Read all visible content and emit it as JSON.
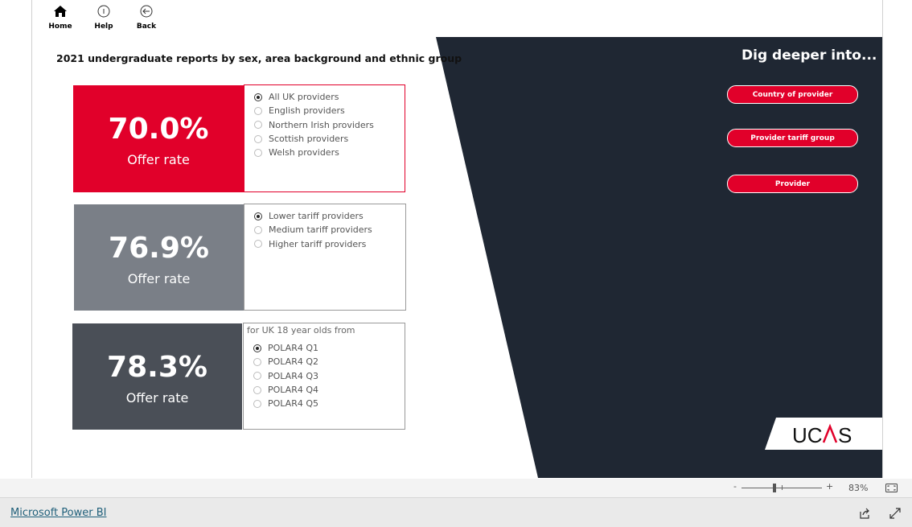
{
  "nav": {
    "home": "Home",
    "help": "Help",
    "back": "Back"
  },
  "title": "2021 undergraduate reports by sex, area background and ethnic group",
  "cards": [
    {
      "value": "70.0%",
      "label": "Offer rate",
      "color": "#e1002a",
      "options": [
        "All UK providers",
        "English providers",
        "Northern Irish providers",
        "Scottish providers",
        "Welsh providers"
      ],
      "selected": 0
    },
    {
      "value": "76.9%",
      "label": "Offer rate",
      "color": "#7a7f87",
      "options": [
        "Lower tariff providers",
        "Medium tariff providers",
        "Higher tariff providers"
      ],
      "selected": 0
    },
    {
      "value": "78.3%",
      "label": "Offer rate",
      "color": "#4a4f57",
      "header": "for UK 18 year olds from",
      "options": [
        "POLAR4 Q1",
        "POLAR4 Q2",
        "POLAR4 Q3",
        "POLAR4 Q4",
        "POLAR4 Q5"
      ],
      "selected": 0
    }
  ],
  "dig": {
    "title": "Dig deeper into...",
    "buttons": [
      "Country of provider",
      "Provider tariff group",
      "Provider"
    ]
  },
  "logo": "UCAS",
  "status": {
    "zoom": "83%",
    "minus": "-",
    "plus": "+",
    "zoom_level": 0.4
  },
  "footer": {
    "link": "Microsoft Power BI"
  },
  "colors": {
    "accent": "#e1002a",
    "dark": "#1f2733"
  }
}
